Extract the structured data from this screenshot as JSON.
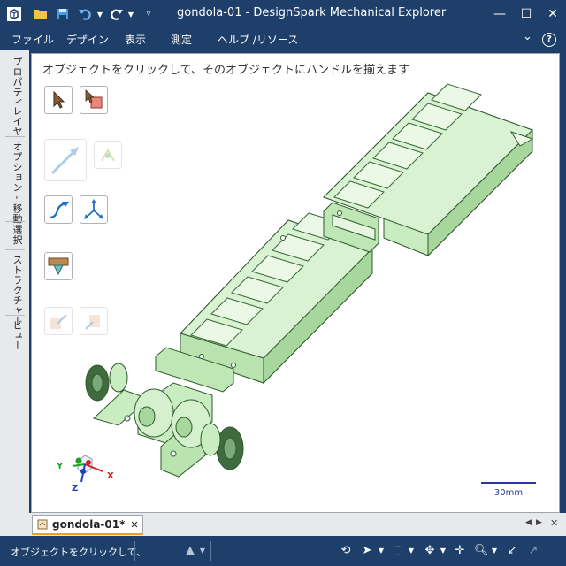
{
  "window": {
    "title": "gondola-01 - DesignSpark Mechanical Explorer",
    "minimize": "—",
    "maximize": "☐",
    "close": "✕"
  },
  "quick_access": [
    {
      "name": "app-logo-icon"
    },
    {
      "name": "open-folder-icon"
    },
    {
      "name": "save-icon"
    },
    {
      "name": "undo-icon"
    },
    {
      "name": "redo-icon"
    },
    {
      "name": "customize-toolbar-icon"
    }
  ],
  "menu": {
    "items": [
      "ファイル",
      "デザイン",
      "表示",
      "測定",
      "ヘルプ /リソース"
    ],
    "collapse": "⌄",
    "help": "?"
  },
  "side_tabs": [
    "プロパティ",
    "レイヤ",
    "オプション - 移動",
    "選択",
    "ストラクチャー",
    "ビュー"
  ],
  "viewport": {
    "hint": "オブジェクトをクリックして、そのオブジェクトにハンドルを揃えます",
    "scale_label": "30mm",
    "axes": {
      "x": "X",
      "y": "Y",
      "z": "Z"
    }
  },
  "tools": [
    {
      "name": "select-tool",
      "state": "enabled"
    },
    {
      "name": "select-component-tool",
      "state": "enabled"
    },
    {
      "name": "move-handle-tool",
      "state": "disabled"
    },
    {
      "name": "anchor-tool",
      "state": "disabled"
    },
    {
      "name": "move-along-path-tool",
      "state": "enabled"
    },
    {
      "name": "pivot-tool",
      "state": "enabled"
    },
    {
      "name": "ruler-tool",
      "state": "enabled"
    },
    {
      "name": "up-to-tool",
      "state": "disabled"
    },
    {
      "name": "orient-tool",
      "state": "disabled"
    }
  ],
  "tabs": {
    "doc_tab": "gondola-01*",
    "close": "✕"
  },
  "status": {
    "text": "オブジェクトをクリックして、"
  },
  "colors": {
    "chrome": "#1e3f6a",
    "model_fill": "#c9ecc0",
    "model_edge": "#2f5a2f",
    "wheel": "#3f6b3f",
    "accent": "#f0a020"
  }
}
